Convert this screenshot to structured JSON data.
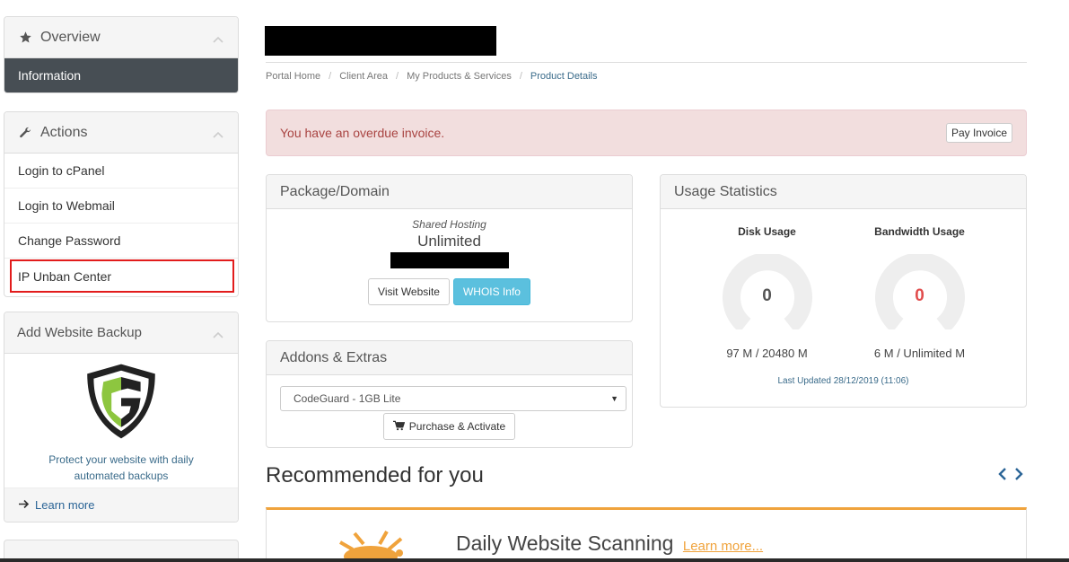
{
  "sidebar": {
    "overview": {
      "title": "Overview",
      "items": [
        {
          "label": "Information",
          "active": true
        }
      ]
    },
    "actions": {
      "title": "Actions",
      "items": [
        {
          "label": "Login to cPanel"
        },
        {
          "label": "Login to Webmail"
        },
        {
          "label": "Change Password"
        },
        {
          "label": "IP Unban Center"
        }
      ]
    },
    "backup": {
      "title": "Add Website Backup",
      "description_line1": "Protect your website with daily",
      "description_line2": "automated backups",
      "learn_more": "Learn more",
      "logo_colors": {
        "green": "#8dc63f",
        "dark": "#222222"
      }
    }
  },
  "breadcrumb": [
    "Portal Home",
    "Client Area",
    "My Products & Services",
    "Product Details"
  ],
  "alert": {
    "text": "You have an overdue invoice.",
    "button": "Pay Invoice"
  },
  "package": {
    "title": "Package/Domain",
    "type": "Shared Hosting",
    "name": "Unlimited",
    "visit_button": "Visit Website",
    "whois_button": "WHOIS Info"
  },
  "addons": {
    "title": "Addons & Extras",
    "selected": "CodeGuard - 1GB Lite",
    "purchase_button": "Purchase & Activate"
  },
  "usage": {
    "title": "Usage Statistics",
    "disk": {
      "label": "Disk Usage",
      "value": "0",
      "amount": "97 M / 20480 M"
    },
    "bandwidth": {
      "label": "Bandwidth Usage",
      "value": "0",
      "amount": "6 M / Unlimited M"
    },
    "last_updated": "Last Updated 28/12/2019 (11:06)"
  },
  "recommended": {
    "title": "Recommended for you",
    "item_title": "Daily Website Scanning",
    "item_link": "Learn more..."
  },
  "colors": {
    "accent": "#f0a33c",
    "alert_bg": "#f2dede",
    "info": "#5bc0de",
    "highlight": "#e21c1c",
    "sidebar_active": "#474e54"
  }
}
